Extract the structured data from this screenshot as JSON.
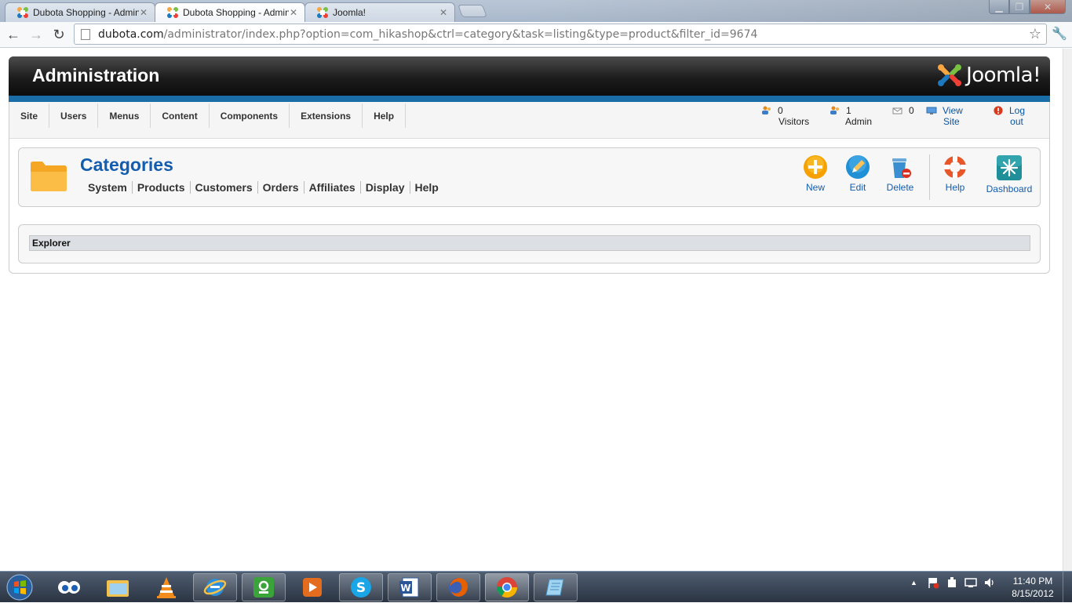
{
  "browser": {
    "tabs": [
      {
        "title": "Dubota Shopping - Admin",
        "active": false
      },
      {
        "title": "Dubota Shopping - Admin",
        "active": true
      },
      {
        "title": "Joomla!",
        "active": false
      }
    ],
    "url_host": "dubota.com",
    "url_rest": "/administrator/index.php?option=com_hikashop&ctrl=category&task=listing&type=product&filter_id=9674"
  },
  "header": {
    "title": "Administration",
    "logo_text": "Joomla!"
  },
  "menu": {
    "items": [
      "Site",
      "Users",
      "Menus",
      "Content",
      "Components",
      "Extensions",
      "Help"
    ]
  },
  "status": {
    "visitors_count": "0",
    "visitors_label": "Visitors",
    "admin_count": "1",
    "admin_label": "Admin",
    "messages_count": "0",
    "view_site_line1": "View",
    "view_site_line2": "Site",
    "logout_line1": "Log",
    "logout_line2": "out"
  },
  "page": {
    "title": "Categories",
    "submenu": [
      "System",
      "Products",
      "Customers",
      "Orders",
      "Affiliates",
      "Display",
      "Help"
    ],
    "toolbar": {
      "new": "New",
      "edit": "Edit",
      "delete": "Delete",
      "help": "Help",
      "dashboard": "Dashboard"
    },
    "explorer_label": "Explorer"
  },
  "taskbar": {
    "time": "11:40 PM",
    "date": "8/15/2012"
  },
  "colors": {
    "joomla_blue": "#1a6ea8",
    "link_blue": "#135cae",
    "header_dark": "#1c1c1c"
  }
}
